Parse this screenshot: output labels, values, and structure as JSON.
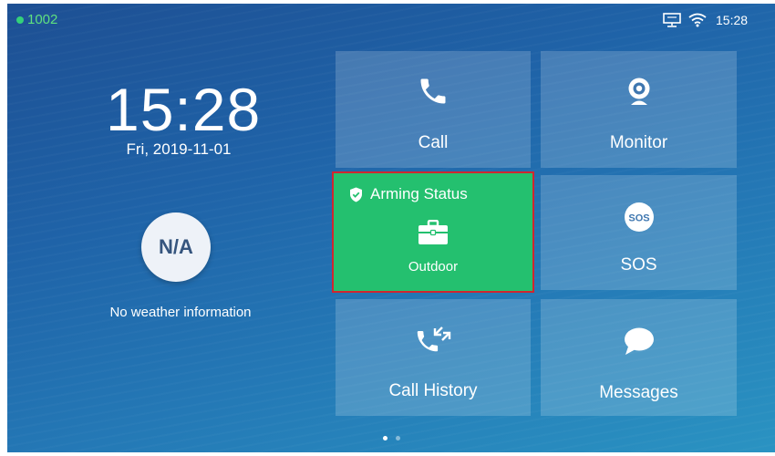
{
  "status_bar": {
    "extension": "1002",
    "time": "15:28",
    "icons": [
      "network-icon",
      "wifi-icon"
    ],
    "extension_color": "#5fe07f"
  },
  "clock": {
    "time": "15:28",
    "date": "Fri, 2019-11-01"
  },
  "weather": {
    "badge": "N/A",
    "info": "No weather information"
  },
  "tiles": {
    "call": {
      "label": "Call",
      "icon": "phone-icon"
    },
    "monitor": {
      "label": "Monitor",
      "icon": "webcam-icon"
    },
    "arming": {
      "title": "Arming Status",
      "mode": "Outdoor",
      "icon": "briefcase-icon",
      "status_icon": "shield-check-icon",
      "color": "#24c06f",
      "highlight_color": "#d0262f"
    },
    "sos": {
      "label": "SOS",
      "badge": "SOS",
      "icon": "sos-icon"
    },
    "call_history": {
      "label": "Call History",
      "icon": "call-history-icon"
    },
    "messages": {
      "label": "Messages",
      "icon": "chat-bubble-icon"
    }
  },
  "pagination": {
    "total": 2,
    "current": 1
  }
}
